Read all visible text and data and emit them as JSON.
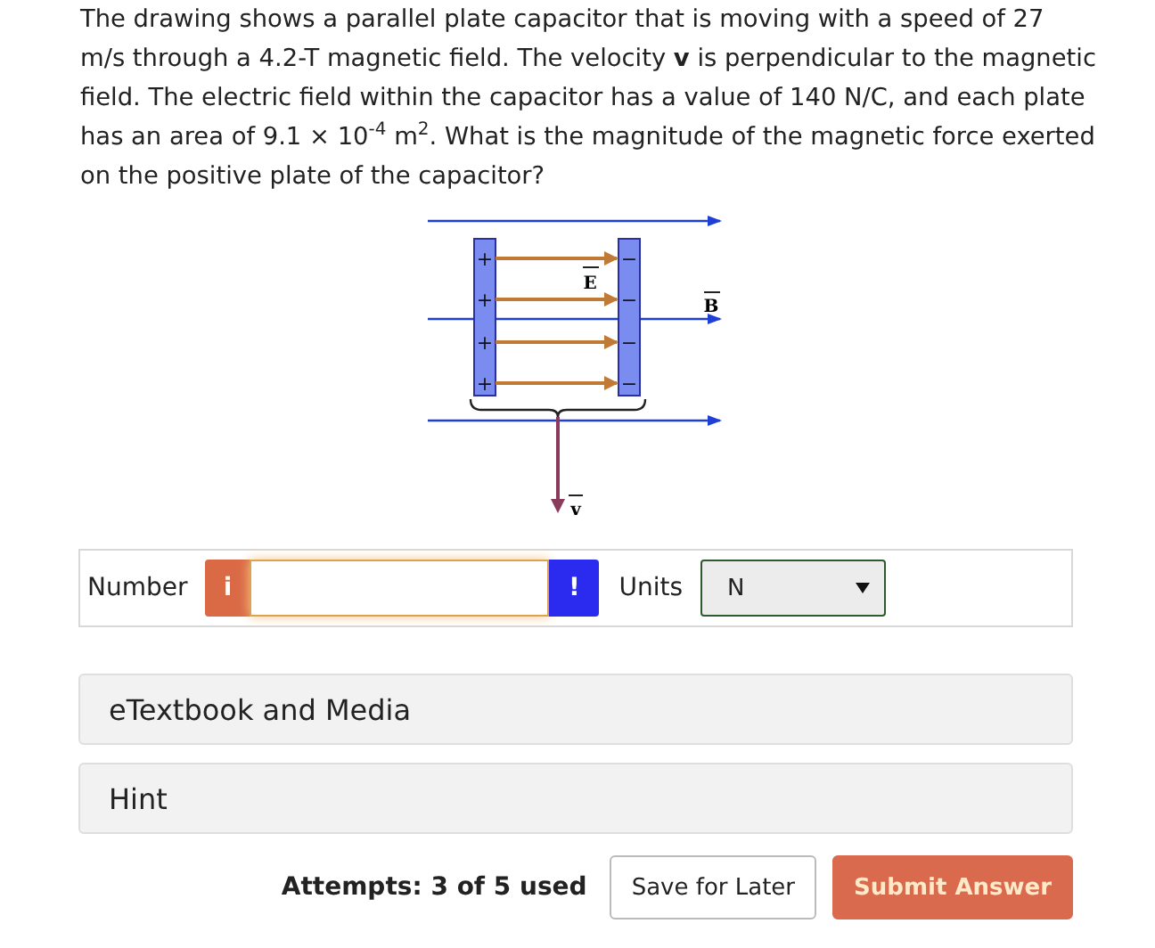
{
  "question": {
    "text": "The drawing shows a parallel plate capacitor that is moving with a speed of 27 m/s through a 4.2-T magnetic field. The velocity **v** is perpendicular to the magnetic field. The electric field within the capacitor has a value of 140 N/C, and each plate has an area of 9.1 × 10$^{-4}$ m$^{2}$. What is the magnitude of the magnetic force exerted on the positive plate of the capacitor?"
  },
  "diagram": {
    "electric_label": "E",
    "magnetic_label": "B",
    "velocity_label": "v",
    "plus_signs": [
      "+",
      "+",
      "+",
      "+"
    ],
    "minus_signs": [
      "−",
      "−",
      "−",
      "−"
    ]
  },
  "answer": {
    "label": "Number",
    "info_icon": "i",
    "alert_icon": "!",
    "units_label": "Units",
    "units_value": "N"
  },
  "panels": [
    {
      "title": "eTextbook and Media"
    },
    {
      "title": "Hint"
    }
  ],
  "attempts": "Attempts: 3 of 5 used",
  "buttons": [
    {
      "label": "Save for Later",
      "kind": "secondary"
    },
    {
      "label": "Submit Answer",
      "kind": "primary"
    }
  ]
}
